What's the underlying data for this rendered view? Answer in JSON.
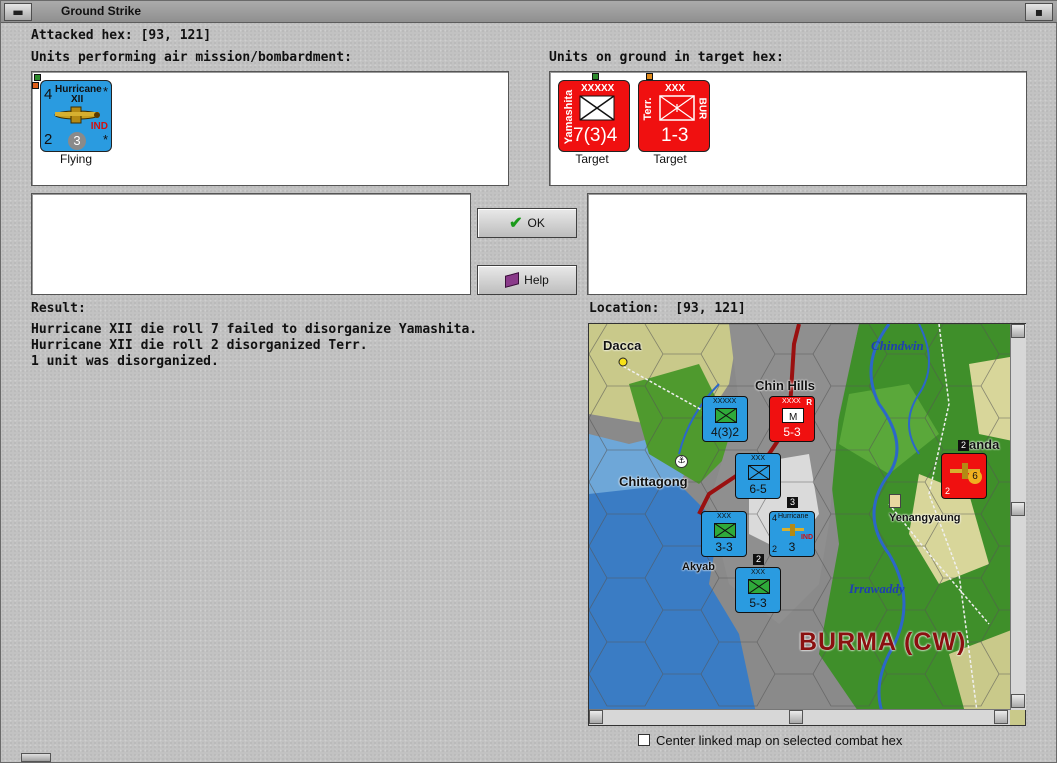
{
  "window": {
    "title": "Ground Strike"
  },
  "attacked_hex": {
    "label": "Attacked hex:",
    "value": "[93, 121]"
  },
  "air_units": {
    "heading": "Units performing air mission/bombardment:",
    "units": [
      {
        "name_line1": "Hurricane",
        "name_line2": "XII",
        "attack": "4",
        "defense": "2",
        "range": "3",
        "nation": "IND",
        "star_top": "*",
        "star_bottom": "*",
        "status": "Flying",
        "color": "#2a9be0"
      }
    ]
  },
  "ground_units": {
    "heading": "Units on ground in target hex:",
    "units": [
      {
        "name": "Yamashita",
        "size": "XXXXX",
        "strength": "7(3)4",
        "status": "Target",
        "color": "#f01010"
      },
      {
        "name": "Terr.",
        "size": "XXX",
        "strength": "1-3",
        "nation": "BUR",
        "status": "Target",
        "color": "#f01010"
      }
    ]
  },
  "buttons": {
    "ok_label": "OK",
    "help_label": "Help"
  },
  "result": {
    "heading": "Result:",
    "lines": [
      "Hurricane XII die roll 7 failed to disorganize Yamashita.",
      "Hurricane XII die roll 2 disorganized Terr.",
      "1 unit was disorganized."
    ]
  },
  "location": {
    "label": "Location:",
    "value": "[93, 121]"
  },
  "map": {
    "places": [
      "Dacca",
      "Chin Hills",
      "Chittagong",
      "Akyab",
      "Yenangyaung",
      "anda"
    ],
    "rivers": [
      "Chindwin",
      "Irrawaddy"
    ],
    "region": "BURMA (CW)",
    "counters": [
      {
        "size": "XXXXX",
        "strength": "4(3)2",
        "color": "#2a9be0"
      },
      {
        "size": "XXXX",
        "strength": "5-3",
        "color": "#f01010",
        "badge": "R"
      },
      {
        "size": "XXX",
        "strength": "6-5",
        "color": "#2a9be0"
      },
      {
        "size": "XXX",
        "strength": "3-3",
        "color": "#2a9be0"
      },
      {
        "size": "XXX",
        "strength": "5-3",
        "color": "#2a9be0"
      },
      {
        "size": "Hurricane",
        "strength": "3",
        "color": "#2a9be0",
        "nation": "IND",
        "attack": "4",
        "defense": "2"
      },
      {
        "size": "",
        "strength": "6",
        "color": "#f01010",
        "attack": "2"
      }
    ],
    "stack_counts": [
      "3",
      "2",
      "2"
    ]
  },
  "checkbox": {
    "label": "Center linked map on selected combat hex",
    "checked": false
  }
}
